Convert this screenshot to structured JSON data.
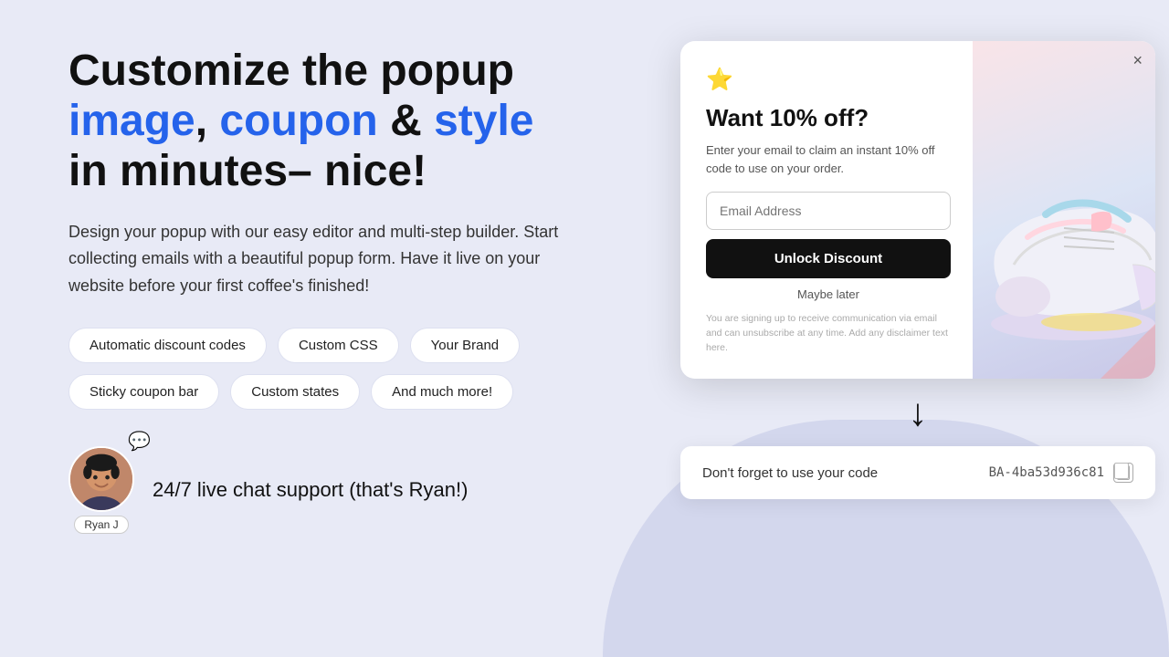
{
  "page": {
    "bg_color": "#e8eaf6"
  },
  "left": {
    "headline_part1": "Customize the popup",
    "headline_blue1": "image",
    "headline_comma": ",",
    "headline_blue2": "coupon",
    "headline_and": " & ",
    "headline_blue3": "style",
    "headline_part2": "in minutes– nice!",
    "subtext": "Design your popup with our easy editor and multi-step builder. Start collecting emails with a beautiful popup form. Have it live on your website before your first coffee's finished!",
    "tags": [
      "Automatic discount codes",
      "Custom CSS",
      "Your Brand",
      "Sticky coupon bar",
      "Custom states",
      "And much more!"
    ],
    "support_text": "24/7 live chat support",
    "support_subtext": "(that's Ryan!)",
    "avatar_label": "Ryan J"
  },
  "popup": {
    "close_symbol": "×",
    "star_emoji": "✦",
    "title": "Want 10% off?",
    "description": "Enter your email to claim an instant 10% off code to use on your order.",
    "email_placeholder": "Email Address",
    "button_label": "Unlock Discount",
    "skip_label": "Maybe later",
    "legal_text": "You are signing up to receive communication via email and can unsubscribe at any time. Add any disclaimer text here."
  },
  "arrow": {
    "symbol": "↓"
  },
  "coupon": {
    "label": "Don't forget to use your code",
    "code": "BA-4ba53d936c81"
  }
}
